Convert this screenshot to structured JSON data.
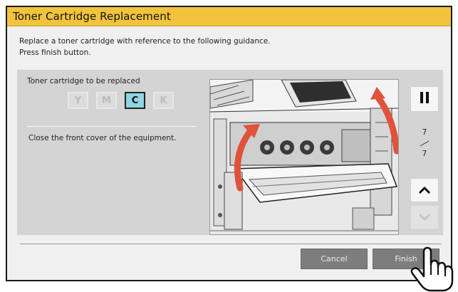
{
  "window": {
    "title": "Toner Cartridge Replacement"
  },
  "guidance": {
    "line1": "Replace a toner cartridge with reference to the following guidance.",
    "line2": "Press finish button."
  },
  "cartridge": {
    "label": "Toner cartridge to be replaced",
    "options": [
      "Y",
      "M",
      "C",
      "K"
    ],
    "selected": "C"
  },
  "step": {
    "instruction": "Close the front cover of the equipment.",
    "current": "7",
    "total": "7"
  },
  "illustration": {
    "description_icon": "printer-front-cover-closing-illustration"
  },
  "controls": {
    "pause_icon": "pause-icon",
    "up_icon": "chevron-up-icon",
    "down_icon": "chevron-down-icon",
    "down_enabled": false
  },
  "footer": {
    "cancel_label": "Cancel",
    "finish_label": "Finish"
  },
  "colors": {
    "title_bar": "#f2c43d",
    "selected_cartridge": "#8fd6e2",
    "arrow": "#e0523a",
    "button": "#7d7d7d"
  }
}
